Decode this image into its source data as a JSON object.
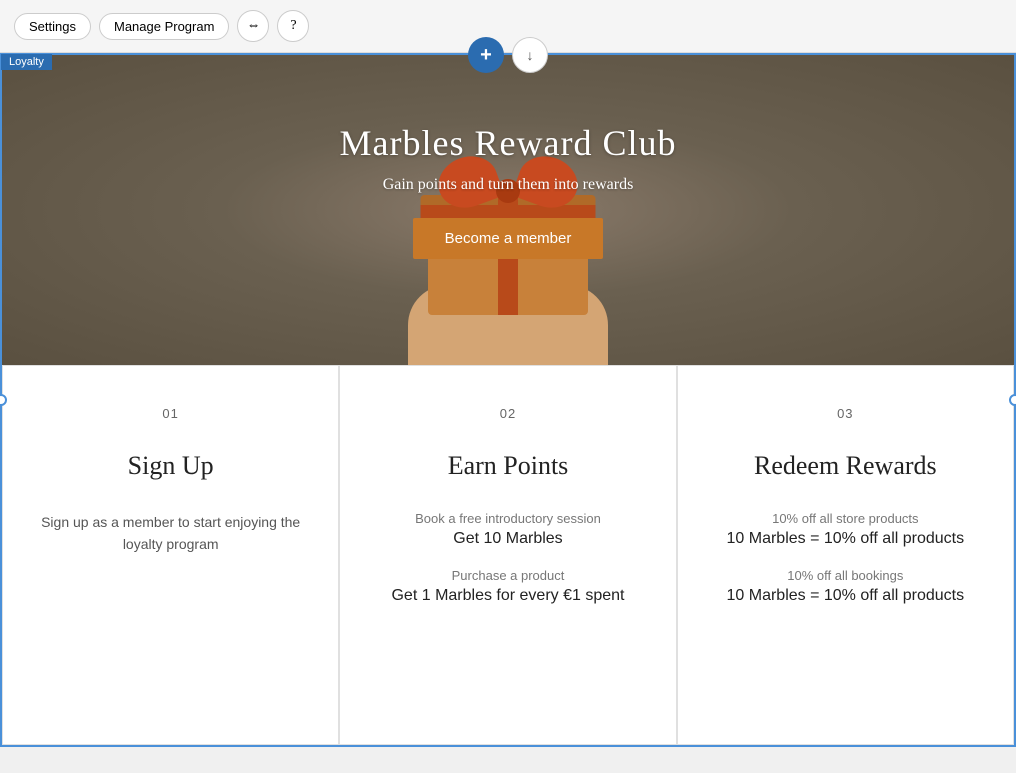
{
  "toolbar": {
    "settings_label": "Settings",
    "manage_label": "Manage Program",
    "arrows_icon": "⇔",
    "help_icon": "?"
  },
  "loyalty_tag": "Loyalty",
  "float_actions": {
    "plus_icon": "+",
    "download_icon": "↓"
  },
  "hero": {
    "title": "Marbles Reward Club",
    "subtitle": "Gain points and turn them into rewards",
    "cta_button": "Become a member"
  },
  "cards": [
    {
      "number": "01",
      "title": "Sign Up",
      "description": "Sign up as a member to start enjoying the loyalty program",
      "items": []
    },
    {
      "number": "02",
      "title": "Earn Points",
      "description": "",
      "items": [
        {
          "label": "Book a free introductory session",
          "value": "Get 10 Marbles"
        },
        {
          "label": "Purchase a product",
          "value": "Get 1 Marbles for every €1 spent"
        }
      ]
    },
    {
      "number": "03",
      "title": "Redeem Rewards",
      "description": "",
      "items": [
        {
          "label": "10% off all store products",
          "value": "10 Marbles = 10% off all products"
        },
        {
          "label": "10% off all bookings",
          "value": "10 Marbles = 10% off all products"
        }
      ]
    }
  ]
}
